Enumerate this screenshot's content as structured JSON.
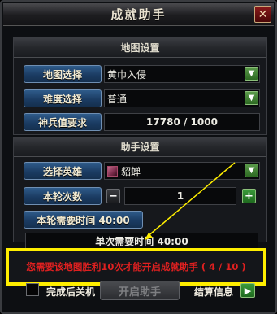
{
  "window": {
    "title": "成就助手",
    "close_symbol": "✕"
  },
  "map_settings": {
    "header": "地图设置",
    "map_select_label": "地图选择",
    "map_value": "黄巾入侵",
    "difficulty_label": "难度选择",
    "difficulty_value": "普通",
    "weapon_label": "神兵值要求",
    "weapon_value": "17780 / 1000"
  },
  "helper_settings": {
    "header": "助手设置",
    "hero_label": "选择英雄",
    "hero_value": "貂蝉",
    "rounds_label": "本轮次数",
    "rounds_value": "1",
    "round_time_label": "本轮需要时间 40:00",
    "single_time_label": "单次需要时间 40:00"
  },
  "warning": "您需要该地图胜利10次才能开启成就助手 ( 4 / 10 )",
  "footer": {
    "shutdown_label": "完成后关机",
    "start_label": "开启助手",
    "result_label": "结算信息"
  },
  "colors": {
    "warning_border": "#ffee00",
    "warning_text": "#e02020",
    "accent_blue": "#2f5b8a"
  }
}
